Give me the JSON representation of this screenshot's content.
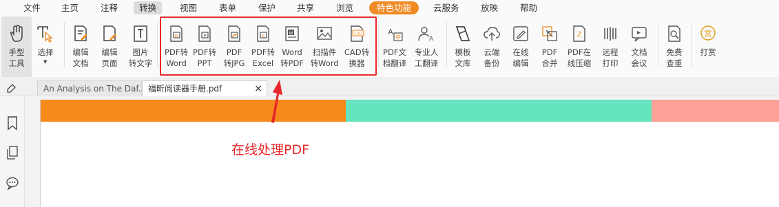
{
  "menu": {
    "items": [
      "文件",
      "主页",
      "注释",
      "转换",
      "视图",
      "表单",
      "保护",
      "共享",
      "浏览",
      "特色功能",
      "云服务",
      "放映",
      "帮助"
    ],
    "active": "转换",
    "highlight": "特色功能"
  },
  "toolbar": {
    "tools": [
      {
        "label": "手型\n工具",
        "icon": "hand-icon"
      },
      {
        "label": "选择",
        "icon": "select-cursor-icon"
      },
      {
        "label": "编辑\n文档",
        "icon": "edit-document-icon"
      },
      {
        "label": "编辑\n页面",
        "icon": "edit-page-icon"
      },
      {
        "label": "图片\n转文字",
        "icon": "image-to-text-icon"
      },
      {
        "label": "PDF转\nWord",
        "icon": "pdf-to-word-icon"
      },
      {
        "label": "PDF转\nPPT",
        "icon": "pdf-to-ppt-icon"
      },
      {
        "label": "PDF\n转JPG",
        "icon": "pdf-to-jpg-icon"
      },
      {
        "label": "PDF转\nExcel",
        "icon": "pdf-to-excel-icon"
      },
      {
        "label": "Word\n转PDF",
        "icon": "word-to-pdf-icon"
      },
      {
        "label": "扫描件\n转Word",
        "icon": "scan-to-word-icon"
      },
      {
        "label": "CAD转\n换器",
        "icon": "cad-converter-icon"
      },
      {
        "label": "PDF文\n档翻译",
        "icon": "pdf-translate-icon"
      },
      {
        "label": "专业人\n工翻译",
        "icon": "human-translation-icon"
      },
      {
        "label": "模板\n文库",
        "icon": "template-library-icon"
      },
      {
        "label": "云端\n备份",
        "icon": "cloud-backup-icon"
      },
      {
        "label": "在线\n编辑",
        "icon": "online-edit-icon"
      },
      {
        "label": "PDF\n合并",
        "icon": "pdf-merge-icon"
      },
      {
        "label": "PDF在\n线压缩",
        "icon": "pdf-compress-icon"
      },
      {
        "label": "远程\n打印",
        "icon": "remote-print-icon"
      },
      {
        "label": "文档\n会议",
        "icon": "document-meeting-icon"
      },
      {
        "label": "免费\n查重",
        "icon": "plagiarism-check-icon"
      },
      {
        "label": "打赏",
        "icon": "reward-icon"
      }
    ]
  },
  "tabs": [
    {
      "title": "An Analysis on The Daf..."
    },
    {
      "title": "福昕阅读器手册.pdf",
      "close": "×"
    }
  ],
  "annotation": {
    "text": "在线处理PDF"
  },
  "colors": {
    "accent": "#f08a24",
    "annotation_red": "#e8282b",
    "band_orange": "#f78a1d",
    "band_green": "#66e4c0",
    "band_pink": "#ffa196"
  }
}
